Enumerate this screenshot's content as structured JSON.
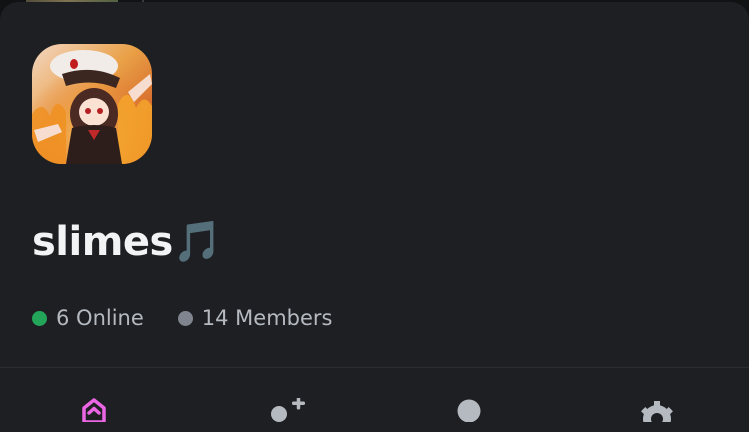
{
  "server": {
    "name": "slimes🎵",
    "icon": "anime-avatar-server-icon",
    "online": "6 Online",
    "members": "14 Members"
  },
  "colors": {
    "background": "#1e1f22",
    "online_dot": "#23a55a",
    "members_dot": "#80848e",
    "boost_icon": "#eb66e4"
  },
  "bottom_icons": [
    "boost-icon",
    "invite-icon",
    "notifications-icon",
    "settings-icon"
  ]
}
